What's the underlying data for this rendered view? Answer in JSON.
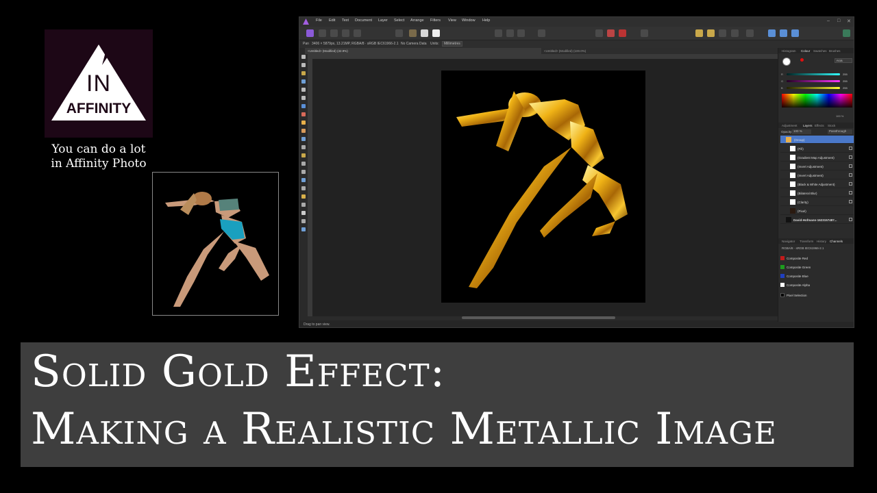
{
  "branding": {
    "logo_in": "IN",
    "logo_affinity": "AFFINITY",
    "tagline_line1": "You can do a lot",
    "tagline_line2": "in Affinity Photo"
  },
  "app": {
    "menu": [
      "File",
      "Edit",
      "Text",
      "Document",
      "Layer",
      "Select",
      "Arrange",
      "Filters",
      "View",
      "Window",
      "Help"
    ],
    "context_bar": {
      "pixel_info": "3406 × 5879px, 13.21MP, RGBA/8 · sRGB IEC61966-2.1",
      "camera_data": "No Camera Data",
      "units_label": "Units:",
      "units_value": "Millimetres"
    },
    "tabs": [
      {
        "label": "<Untitled> (Modified) (32.9%)"
      },
      {
        "label": "<Untitled> (Modified) (100.0%)"
      }
    ],
    "status_text": "Drag to pan view.",
    "panels": {
      "top_tabs": [
        "Histogram",
        "Colour",
        "Swatches",
        "Brushes"
      ],
      "color_model": "RGB",
      "sliders": [
        {
          "label": "R",
          "value": "255",
          "color": "#f33"
        },
        {
          "label": "G",
          "value": "255",
          "color": "#f3f"
        },
        {
          "label": "B",
          "value": "255",
          "color": "#ff3"
        }
      ],
      "opacity_readout": "100 %",
      "mid_tabs": [
        "Adjustment",
        "Layers",
        "Effects",
        "Stock"
      ],
      "opacity_label": "Opacity:",
      "opacity_value": "100 %",
      "blend_mode": "Passthrough",
      "layers": [
        {
          "name": "(Group)"
        },
        {
          "name": "(Fill)"
        },
        {
          "name": "(Gradient Map Adjustment)"
        },
        {
          "name": "(Invert Adjustment)"
        },
        {
          "name": "(Invert Adjustment)"
        },
        {
          "name": "(Black & White Adjustment)"
        },
        {
          "name": "(Bilateral Blur)"
        },
        {
          "name": "(Clarity)"
        },
        {
          "name": "(Pixel)"
        },
        {
          "name": "David-Hofmann-1623157487..."
        }
      ],
      "bottom_tabs": [
        "Navigator",
        "Transform",
        "History",
        "Channels"
      ],
      "channel_header": "RGBA/8 · sRGB IEC61966-2.1",
      "channels": [
        {
          "name": "Composite Red",
          "color": "#c21b1b"
        },
        {
          "name": "Composite Green",
          "color": "#1e9b1e"
        },
        {
          "name": "Composite Blue",
          "color": "#1f3fbf"
        },
        {
          "name": "Composite Alpha",
          "color": "#ffffff"
        },
        {
          "name": "Pixel Selection",
          "color": "#000000"
        }
      ]
    }
  },
  "banner": {
    "line1": "Solid Gold Effect:",
    "line2": "Making a Realistic Metallic Image"
  }
}
